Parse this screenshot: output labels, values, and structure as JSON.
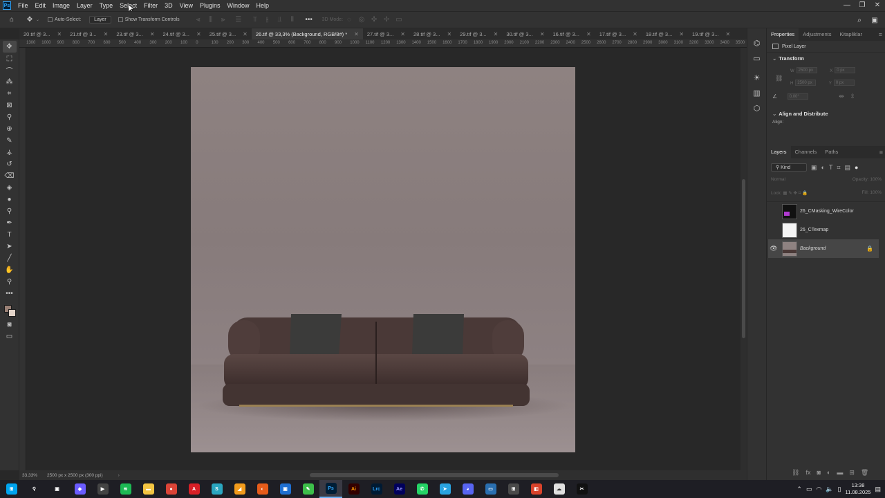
{
  "app": {
    "name": "Photoshop",
    "logo": "Ps"
  },
  "menu": [
    "File",
    "Edit",
    "Image",
    "Layer",
    "Type",
    "Select",
    "Filter",
    "3D",
    "View",
    "Plugins",
    "Window",
    "Help"
  ],
  "options": {
    "auto_select_label": "Auto-Select:",
    "auto_select_value": "Layer",
    "show_transform_label": "Show Transform Controls",
    "mode_3d_label": "3D Mode:"
  },
  "tabs": [
    {
      "label": "20.tif @ 3...",
      "active": false
    },
    {
      "label": "21.tif @ 3...",
      "active": false
    },
    {
      "label": "23.tif @ 3...",
      "active": false
    },
    {
      "label": "24.tif @ 3...",
      "active": false
    },
    {
      "label": "25.tif @ 3...",
      "active": false
    },
    {
      "label": "26.tif @ 33,3% (Background, RGB/8#) *",
      "active": true
    },
    {
      "label": "27.tif @ 3...",
      "active": false
    },
    {
      "label": "28.tif @ 3...",
      "active": false
    },
    {
      "label": "29.tif @ 3...",
      "active": false
    },
    {
      "label": "30.tif @ 3...",
      "active": false
    },
    {
      "label": "16.tif @ 3...",
      "active": false
    },
    {
      "label": "17.tif @ 3...",
      "active": false
    },
    {
      "label": "18.tif @ 3...",
      "active": false
    },
    {
      "label": "19.tif @ 3...",
      "active": false
    }
  ],
  "ruler_ticks": [
    "1300",
    "1000",
    "900",
    "800",
    "700",
    "600",
    "500",
    "400",
    "300",
    "200",
    "100",
    "0",
    "100",
    "200",
    "300",
    "400",
    "500",
    "600",
    "700",
    "800",
    "900",
    "1000",
    "1100",
    "1200",
    "1300",
    "1400",
    "1500",
    "1600",
    "1700",
    "1800",
    "1900",
    "2000",
    "2100",
    "2200",
    "2300",
    "2400",
    "2500",
    "2600",
    "2700",
    "2800",
    "2900",
    "3000",
    "3100",
    "3200",
    "3300",
    "3400",
    "3500"
  ],
  "colors": {
    "foreground": "#9a8176",
    "background": "#e2d3c8",
    "accent": "#31a8ff"
  },
  "status": {
    "zoom": "33,33%",
    "doc_info": "2500 px x 2500 px (300 ppi)"
  },
  "properties": {
    "tabs": [
      "Properties",
      "Adjustments",
      "Kitapliklar"
    ],
    "layer_type": "Pixel Layer",
    "transform_title": "Transform",
    "w_label": "W",
    "w_value": "2500 px",
    "h_label": "H",
    "h_value": "2500 px",
    "x_label": "X",
    "x_value": "0 px",
    "y_label": "Y",
    "y_value": "0 px",
    "angle_value": "0,00°",
    "align_title": "Align and Distribute",
    "align_label": "Align:"
  },
  "layers_panel": {
    "tabs": [
      "Layers",
      "Channels",
      "Paths"
    ],
    "filter_label": "Kind",
    "blend_mode": "Normal",
    "opacity_label": "Opacity:",
    "opacity_value": "100%",
    "lock_label": "Lock:",
    "fill_label": "Fill:",
    "fill_value": "100%",
    "layers": [
      {
        "name": "26_CMasking_WireColor",
        "visible": false,
        "locked": false,
        "active": false
      },
      {
        "name": "26_CTexmap",
        "visible": false,
        "locked": false,
        "active": false
      },
      {
        "name": "Background",
        "visible": true,
        "locked": true,
        "active": true
      }
    ]
  },
  "taskbar": {
    "apps": [
      "windows-start",
      "search",
      "task-view",
      "copilot",
      "media-player",
      "spotify",
      "file-explorer",
      "chrome",
      "acrobat",
      "sublime",
      "office",
      "app-orange",
      "app-blue",
      "app-green",
      "photoshop",
      "illustrator",
      "lightroom-classic",
      "after-effects",
      "whatsapp",
      "telegram",
      "discord",
      "remote-desktop",
      "calculator",
      "app-office2",
      "cloud-app",
      "capcut"
    ],
    "clock_time": "13:38",
    "clock_date": "11.08.2025"
  }
}
